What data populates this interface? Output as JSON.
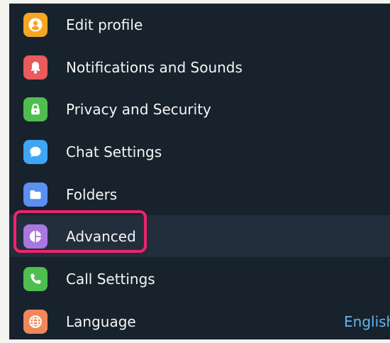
{
  "menu": {
    "items": [
      {
        "label": "Edit profile",
        "icon": "person-icon",
        "color": "#f5a623"
      },
      {
        "label": "Notifications and Sounds",
        "icon": "bell-icon",
        "color": "#ea5b5b"
      },
      {
        "label": "Privacy and Security",
        "icon": "lock-icon",
        "color": "#4fbe4f"
      },
      {
        "label": "Chat Settings",
        "icon": "chat-bubble-icon",
        "color": "#3ea6f2"
      },
      {
        "label": "Folders",
        "icon": "folder-icon",
        "color": "#5b8ff0"
      },
      {
        "label": "Advanced",
        "icon": "pie-chart-icon",
        "color": "#a779e0"
      },
      {
        "label": "Call Settings",
        "icon": "phone-icon",
        "color": "#4fbe4f"
      },
      {
        "label": "Language",
        "icon": "globe-icon",
        "color": "#f0875a",
        "value": "English"
      }
    ]
  },
  "colors": {
    "panel_background": "#18222d",
    "hover_background": "#232e3c",
    "highlight_annotation": "#f0226d",
    "value_text": "#64b5ef"
  }
}
